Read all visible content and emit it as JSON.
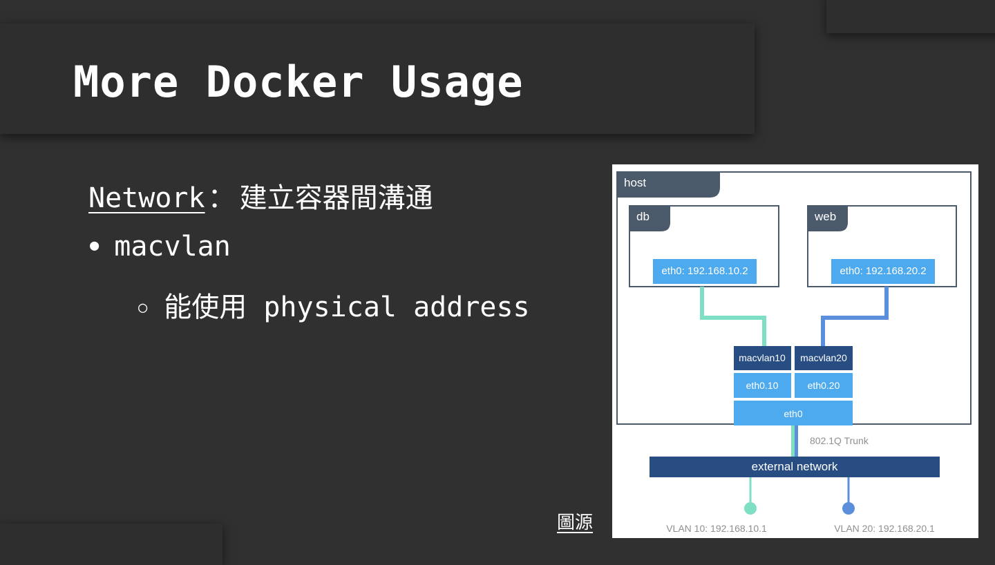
{
  "slide": {
    "title": "More Docker Usage",
    "network_label": "Network",
    "network_separator": "：",
    "network_description": "建立容器間溝通",
    "bullet_marker": "●",
    "bullet_text": "macvlan",
    "sub_bullet_marker": "○",
    "sub_bullet_text": "能使用 physical address",
    "source_link": "圖源"
  },
  "diagram": {
    "host_label": "host",
    "containers": [
      {
        "name": "db",
        "interface": "eth0: 192.168.10.2"
      },
      {
        "name": "web",
        "interface": "eth0: 192.168.20.2"
      }
    ],
    "macvlans": [
      "macvlan10",
      "macvlan20"
    ],
    "subinterfaces": [
      "eth0.10",
      "eth0.20"
    ],
    "physical_interface": "eth0",
    "trunk_label": "802.1Q Trunk",
    "external_label": "external network",
    "vlans": [
      "VLAN 10: 192.168.10.1",
      "VLAN 20: 192.168.20.1"
    ],
    "colors": {
      "tab": "#4a5a6a",
      "light_blue": "#4eaaee",
      "dark_blue": "#274d82",
      "green_link": "#7fdfc4",
      "blue_link": "#5b8fdb"
    }
  }
}
